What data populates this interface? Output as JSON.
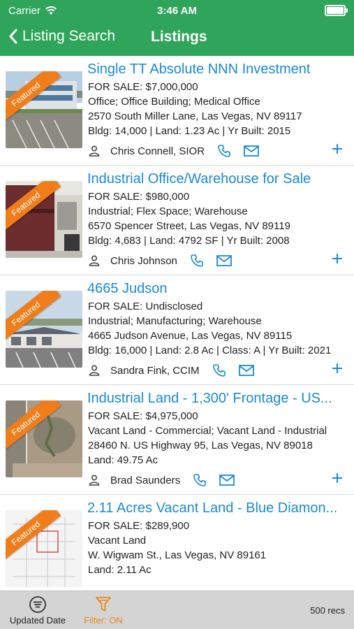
{
  "status_bar": {
    "carrier": "Carrier",
    "time": "3:46 AM"
  },
  "nav": {
    "back_label": "Listing Search",
    "title": "Listings"
  },
  "listings": [
    {
      "title": "Single TT Absolute NNN Investment",
      "price": "FOR SALE: $7,000,000",
      "types": "Office; Office Building; Medical Office",
      "address": "2570 South Miller Lane, Las Vegas, NV 89117",
      "details": "Bldg: 14,000 | Land: 1.23 Ac | Yr Built: 2015",
      "agent": "Chris Connell, SIOR",
      "badge": "Featured"
    },
    {
      "title": "Industrial Office/Warehouse for Sale",
      "price": "FOR SALE: $980,000",
      "types": "Industrial; Flex Space; Warehouse",
      "address": "6570 Spencer Street, Las Vegas, NV 89119",
      "details": "Bldg: 4,683 | Land: 4792 SF | Yr Built: 2008",
      "agent": "Chris Johnson",
      "badge": "Featured"
    },
    {
      "title": "4665 Judson",
      "price": "FOR SALE: Undisclosed",
      "types": "Industrial; Manufacturing; Warehouse",
      "address": "4665 Judson Avenue, Las Vegas, NV 89115",
      "details": "Bldg: 16,000 | Land: 2.8 Ac | Class: A | Yr Built: 2021",
      "agent": "Sandra Fink, CCIM",
      "badge": "Featured"
    },
    {
      "title": "Industrial Land - 1,300' Frontage - US...",
      "price": "FOR SALE: $4,975,000",
      "types": "Vacant Land - Commercial; Vacant Land - Industrial",
      "address": "28460 N. US Highway 95, Las Vegas, NV 89018",
      "details": "Land: 49.75 Ac",
      "agent": "Brad Saunders",
      "badge": "Featured"
    },
    {
      "title": "2.11 Acres Vacant Land - Blue Diamon...",
      "price": "FOR SALE: $289,900",
      "types": "Vacant Land",
      "address": "W. Wigwam St., Las Vegas, NV 89161",
      "details": "Land: 2.11 Ac",
      "agent": "",
      "badge": "Featured"
    }
  ],
  "footer": {
    "sort_label": "Updated Date",
    "filter_label": "Filter: ON",
    "record_count": "500 recs"
  },
  "colors": {
    "header": "#2ea55a",
    "link": "#1a8ad4",
    "ribbon": "#f07d1a",
    "filter": "#e68a1a",
    "footer": "#d4d4d4"
  }
}
